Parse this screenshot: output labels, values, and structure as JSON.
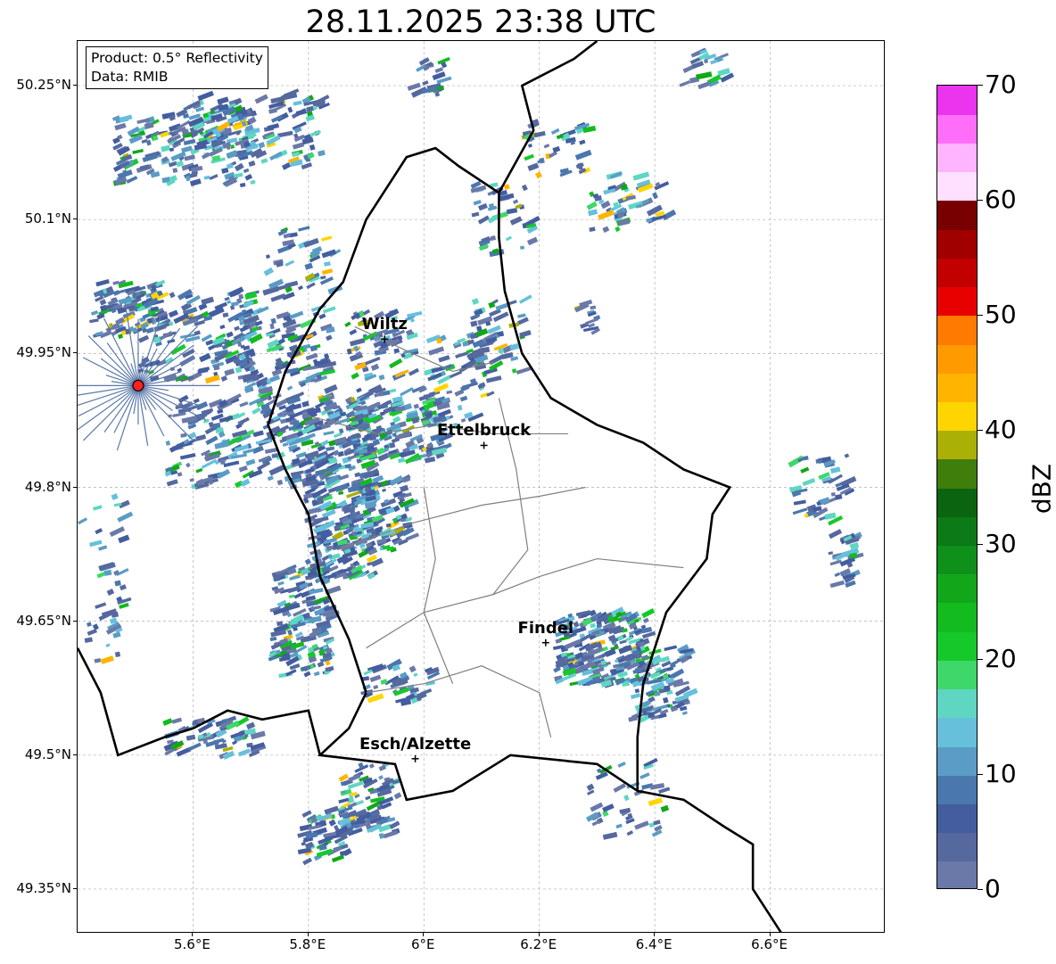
{
  "title": "28.11.2025 23:38 UTC",
  "infobox": {
    "product": "Product: 0.5° Reflectivity",
    "data": "Data: RMIB"
  },
  "map": {
    "lon_range": [
      5.4,
      6.8
    ],
    "lat_range": [
      49.3,
      50.3
    ],
    "lat_ticks": [
      "49.35°N",
      "49.5°N",
      "49.65°N",
      "49.8°N",
      "49.95°N",
      "50.1°N",
      "50.25°N"
    ],
    "lon_ticks": [
      "5.6°E",
      "5.8°E",
      "6°E",
      "6.2°E",
      "6.4°E",
      "6.6°E"
    ],
    "lat_values": [
      49.35,
      49.5,
      49.65,
      49.8,
      49.95,
      50.1,
      50.25
    ],
    "lon_values": [
      5.6,
      5.8,
      6.0,
      6.2,
      6.4,
      6.6
    ],
    "radar_site": {
      "lon": 5.505,
      "lat": 49.914
    },
    "cities": [
      {
        "name": "Wiltz",
        "lon": 5.932,
        "lat": 49.966
      },
      {
        "name": "Ettelbruck",
        "lon": 6.104,
        "lat": 49.847
      },
      {
        "name": "Findel",
        "lon": 6.211,
        "lat": 49.626
      },
      {
        "name": "Esch/Alzette",
        "lon": 5.985,
        "lat": 49.496
      }
    ]
  },
  "colorbar": {
    "label": "dBZ",
    "ticks": [
      "0",
      "10",
      "20",
      "30",
      "40",
      "50",
      "60",
      "70"
    ],
    "min": 0,
    "max": 70,
    "colors": [
      "#6a79a8",
      "#55699f",
      "#435d9f",
      "#4a77ad",
      "#5a9cc5",
      "#66c0dc",
      "#5fd6c2",
      "#3ed86a",
      "#15c92a",
      "#13bb1e",
      "#12a71a",
      "#0e901a",
      "#0c7a16",
      "#0a6410",
      "#3f7e0b",
      "#abb007",
      "#ffd500",
      "#ffb400",
      "#ff9a00",
      "#ff7a00",
      "#e80000",
      "#c30000",
      "#a00000",
      "#780000",
      "#ffe0ff",
      "#ffb4ff",
      "#ff6ef8",
      "#ea34ee"
    ]
  }
}
